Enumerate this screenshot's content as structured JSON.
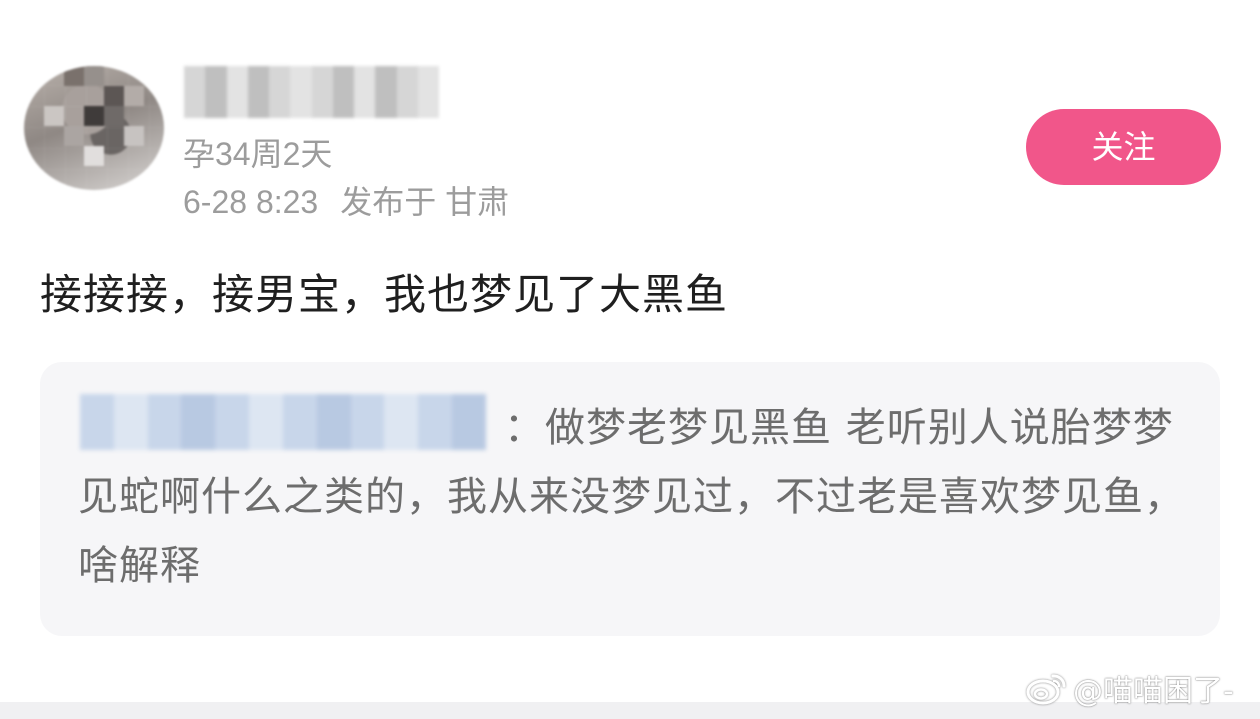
{
  "post": {
    "pregnancy_week": "孕34周2天",
    "post_time": "6-28 8:23",
    "location": "发布于 甘肃",
    "follow_label": "关注",
    "content": "接接接，接男宝，我也梦见了大黑鱼"
  },
  "quoted": {
    "text": "：做梦老梦见黑鱼 老听别人说胎梦梦见蛇啊什么之类的，我从来没梦见过，不过老是喜欢梦见鱼，啥解释"
  },
  "watermark": {
    "text": "@喵喵困了-",
    "icon": "weibo-icon"
  },
  "colors": {
    "accent": "#f1568a",
    "meta_text": "#9c9c9c",
    "quote_bg": "#f6f6f8"
  }
}
